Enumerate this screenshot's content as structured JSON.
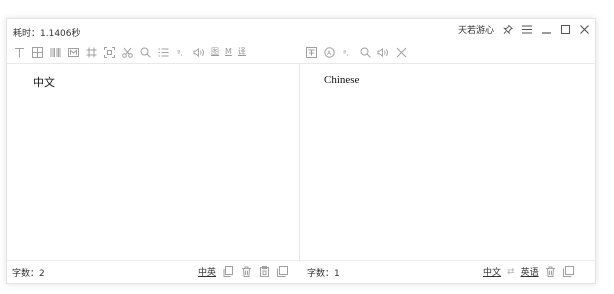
{
  "titlebar": {
    "elapsed": "耗时：1.1406秒",
    "brand": "天若游心"
  },
  "toolbar_left": {
    "icons": [
      "text-cursor-icon",
      "table-icon",
      "barcode-icon",
      "mail-icon",
      "crop-frame-icon",
      "select-frame-icon",
      "cut-icon",
      "search-icon",
      "list-icon",
      "pinyin-icon",
      "speaker-icon"
    ],
    "text_buttons": [
      "图",
      "M",
      "译"
    ]
  },
  "toolbar_right": {
    "icons": [
      "translate-icon",
      "refresh-a-icon",
      "pinyin-icon",
      "search-icon",
      "speaker-icon",
      "close-icon"
    ]
  },
  "left_pane": {
    "text": "中文"
  },
  "right_pane": {
    "text": "Chinese"
  },
  "statusbar": {
    "left_count": "字数：2",
    "left_lang": "中英",
    "right_count": "字数：1",
    "source_lang": "中文",
    "swap_glyph": "⇄",
    "target_lang": "英语"
  }
}
